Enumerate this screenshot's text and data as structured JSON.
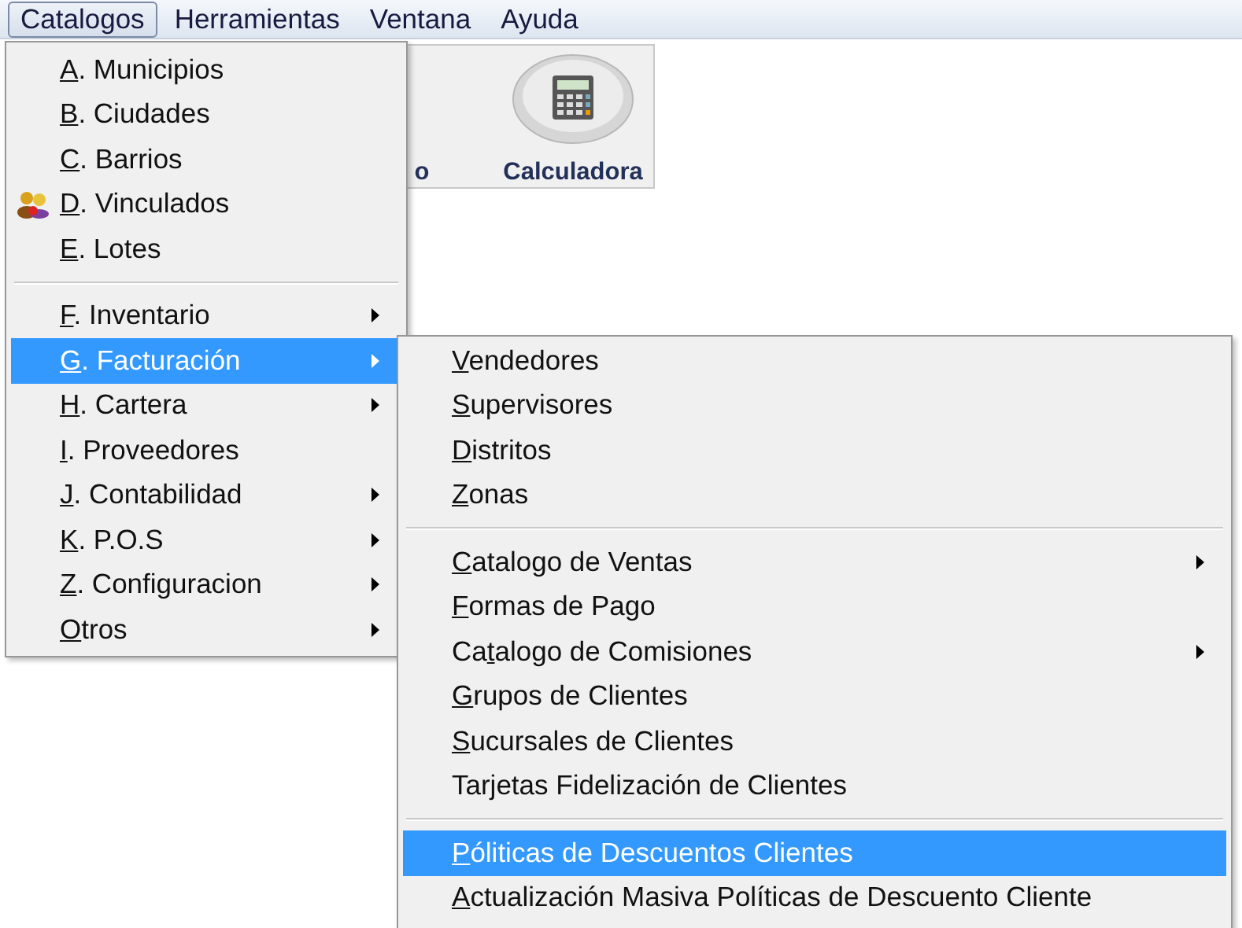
{
  "menubar": [
    {
      "label": "Catalogos",
      "selected": true
    },
    {
      "label": "Herramientas",
      "selected": false
    },
    {
      "label": "Ventana",
      "selected": false
    },
    {
      "label": "Ayuda",
      "selected": false
    }
  ],
  "toolbar": {
    "buttons": [
      {
        "label": "o"
      },
      {
        "label": "Calculadora"
      }
    ]
  },
  "menu": {
    "groups": [
      [
        {
          "key": "A",
          "post": ". Municipios",
          "has_submenu": false,
          "selected": false
        },
        {
          "key": "B",
          "post": ". Ciudades",
          "has_submenu": false,
          "selected": false
        },
        {
          "key": "C",
          "post": ". Barrios",
          "has_submenu": false,
          "selected": false
        },
        {
          "key": "D",
          "post": ". Vinculados",
          "has_submenu": false,
          "selected": false,
          "has_icon": true
        },
        {
          "key": "E",
          "post": ". Lotes",
          "has_submenu": false,
          "selected": false
        }
      ],
      [
        {
          "key": "F",
          "post": ".  Inventario",
          "has_submenu": true,
          "selected": false
        },
        {
          "key": "G",
          "post": ". Facturación",
          "has_submenu": true,
          "selected": true
        },
        {
          "key": "H",
          "post": ". Cartera",
          "has_submenu": true,
          "selected": false
        },
        {
          "key": "I",
          "post": ".  Proveedores",
          "has_submenu": false,
          "selected": false
        },
        {
          "key": "J",
          "post": ". Contabilidad",
          "has_submenu": true,
          "selected": false
        },
        {
          "key": "K",
          "post": ". P.O.S",
          "has_submenu": true,
          "selected": false
        },
        {
          "key": "Z",
          "post": ". Configuracion",
          "has_submenu": true,
          "selected": false
        },
        {
          "key": "O",
          "post": "tros",
          "has_submenu": true,
          "selected": false
        }
      ]
    ]
  },
  "submenu": {
    "groups": [
      [
        {
          "key": "V",
          "post": "endedores",
          "has_submenu": false,
          "selected": false
        },
        {
          "key": "S",
          "post": "upervisores",
          "has_submenu": false,
          "selected": false
        },
        {
          "key": "D",
          "post": "istritos",
          "has_submenu": false,
          "selected": false
        },
        {
          "key": "Z",
          "post": "onas",
          "has_submenu": false,
          "selected": false
        }
      ],
      [
        {
          "key": "C",
          "post": "atalogo de Ventas",
          "has_submenu": true,
          "selected": false
        },
        {
          "key": "F",
          "post": "ormas de Pago",
          "has_submenu": false,
          "selected": false
        },
        {
          "pre": "Ca",
          "key": "t",
          "post": "alogo de Comisiones",
          "has_submenu": true,
          "selected": false
        },
        {
          "key": "G",
          "post": "rupos de Clientes",
          "has_submenu": false,
          "selected": false
        },
        {
          "key": "S",
          "post": "ucursales de Clientes",
          "has_submenu": false,
          "selected": false
        },
        {
          "pre": "Tarjetas Fidelización de Clientes",
          "has_submenu": false,
          "selected": false
        }
      ],
      [
        {
          "key": "P",
          "post": "óliticas de Descuentos Clientes",
          "has_submenu": false,
          "selected": true
        },
        {
          "key": "A",
          "post": "ctualización Masiva Políticas de Descuento Cliente",
          "has_submenu": false,
          "selected": false
        }
      ]
    ]
  }
}
